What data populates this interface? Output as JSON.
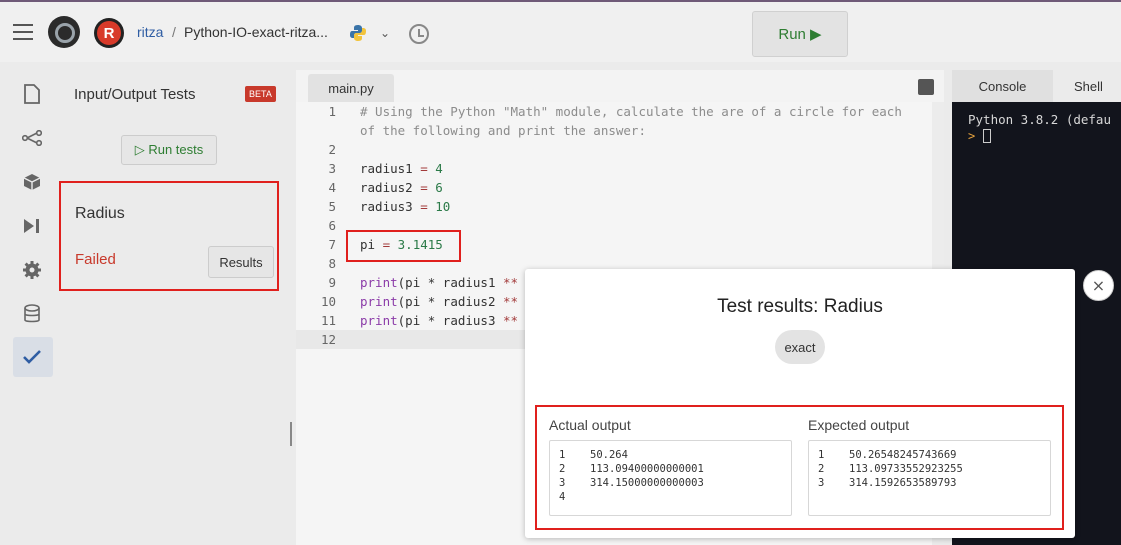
{
  "header": {
    "user": "ritza",
    "separator": "/",
    "repl_name": "Python-IO-exact-ritza...",
    "run_label": "Run ▶"
  },
  "io_panel": {
    "title": "Input/Output Tests",
    "beta": "BETA",
    "run_tests_label": "▷ Run tests",
    "test": {
      "name": "Radius",
      "status": "Failed",
      "results_label": "Results"
    }
  },
  "editor": {
    "tab": "main.py",
    "lines": [
      {
        "num": "1",
        "html": "# Using the Python \"Math\" module, calculate the are of a circle for each"
      },
      {
        "num": "",
        "html": "of the following and print the answer:"
      },
      {
        "num": "2",
        "html": ""
      },
      {
        "num": "3",
        "html": "radius1 = 4"
      },
      {
        "num": "4",
        "html": "radius2 = 6"
      },
      {
        "num": "5",
        "html": "radius3 = 10"
      },
      {
        "num": "6",
        "html": ""
      },
      {
        "num": "7",
        "html": "pi = 3.1415"
      },
      {
        "num": "8",
        "html": ""
      },
      {
        "num": "9",
        "html": "print(pi * radius1 **"
      },
      {
        "num": "10",
        "html": "print(pi * radius2 **"
      },
      {
        "num": "11",
        "html": "print(pi * radius3 **"
      },
      {
        "num": "12",
        "html": ""
      }
    ]
  },
  "console": {
    "tab_console": "Console",
    "tab_shell": "Shell",
    "output": "Python 3.8.2 (defau",
    "prompt": ">"
  },
  "modal": {
    "title": "Test results: Radius",
    "mode": "exact",
    "close": "×",
    "actual_label": "Actual output",
    "expected_label": "Expected output",
    "actual": [
      {
        "n": "1",
        "v": "50.264"
      },
      {
        "n": "2",
        "v": "113.09400000000001"
      },
      {
        "n": "3",
        "v": "314.15000000000003"
      },
      {
        "n": "4",
        "v": ""
      }
    ],
    "expected": [
      {
        "n": "1",
        "v": "50.26548245743669"
      },
      {
        "n": "2",
        "v": "113.09733552923255"
      },
      {
        "n": "3",
        "v": "314.1592653589793"
      }
    ]
  },
  "colors": {
    "accent_red": "#e0201d",
    "run_green": "#2e7d32",
    "failed_red": "#c8392b"
  }
}
